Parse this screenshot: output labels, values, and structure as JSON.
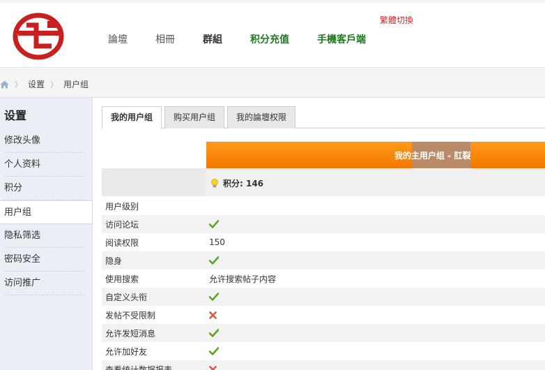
{
  "header": {
    "nav": [
      "論壇",
      "相冊",
      "群組",
      "积分充值",
      "手機客戶端"
    ],
    "lang_switch": "繁體切換",
    "colors": {
      "accent_green": "#1d7a1d",
      "lang_red": "#d42020",
      "logo_red": "#c8201e"
    }
  },
  "breadcrumb": {
    "items": [
      "设置",
      "用户组"
    ]
  },
  "sidebar": {
    "title": "设置",
    "items": [
      "修改头像",
      "个人资料",
      "积分",
      "用户组",
      "隐私筛选",
      "密码安全",
      "访问推广"
    ],
    "active_index": 3
  },
  "tabs": [
    "我的用户组",
    "购买用户组",
    "我的論壇权限"
  ],
  "group_banner": {
    "text": "我的主用户组 - 肛裂",
    "color": "#f27600"
  },
  "points": {
    "label": "积分: 146",
    "icon": "lightbulb-icon"
  },
  "permissions": [
    {
      "label": "用户级别",
      "value": ""
    },
    {
      "label": "访问论坛",
      "value": "yes"
    },
    {
      "label": "阅读权限",
      "value": "150"
    },
    {
      "label": "隐身",
      "value": "yes"
    },
    {
      "label": "使用搜索",
      "value": "允许搜索帖子内容"
    },
    {
      "label": "自定义头衔",
      "value": "yes"
    },
    {
      "label": "发帖不受限制",
      "value": "no"
    },
    {
      "label": "允许发短消息",
      "value": "yes"
    },
    {
      "label": "允许加好友",
      "value": "yes"
    },
    {
      "label": "查看统计数据报表",
      "value": "no"
    }
  ]
}
